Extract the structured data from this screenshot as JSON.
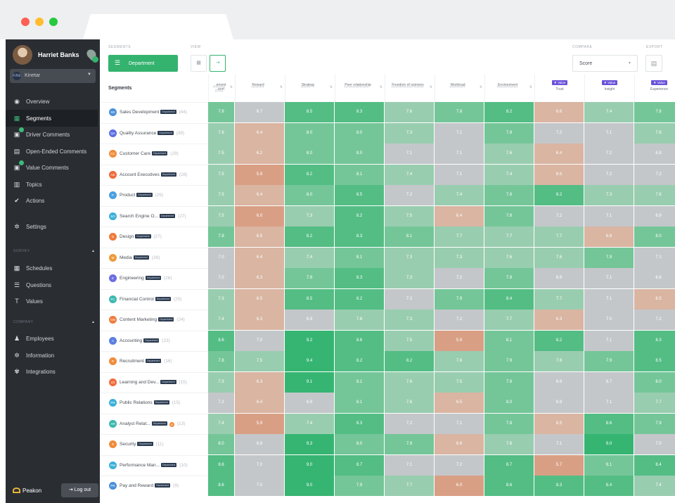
{
  "window": {
    "dots": [
      "#ff5f52",
      "#ffbd2e",
      "#27c93f"
    ]
  },
  "sidebar": {
    "user_name": "Harriet Banks",
    "org_logo": "KINE",
    "org_name": "Kinetar",
    "nav": [
      {
        "label": "Overview",
        "icon": "overview-icon",
        "glyph": "◉",
        "active": false,
        "badge": false
      },
      {
        "label": "Segments",
        "icon": "segments-icon",
        "glyph": "▦",
        "active": true,
        "badge": false
      },
      {
        "label": "Driver Comments",
        "icon": "driver-comments-icon",
        "glyph": "▣",
        "active": false,
        "badge": true
      },
      {
        "label": "Open-Ended Comments",
        "icon": "open-ended-comments-icon",
        "glyph": "▤",
        "active": false,
        "badge": false
      },
      {
        "label": "Value Comments",
        "icon": "value-comments-icon",
        "glyph": "▣",
        "active": false,
        "badge": true
      },
      {
        "label": "Topics",
        "icon": "topics-icon",
        "glyph": "▥",
        "active": false,
        "badge": false
      },
      {
        "label": "Actions",
        "icon": "actions-icon",
        "glyph": "✔",
        "active": false,
        "badge": false
      },
      {
        "label": "Settings",
        "icon": "settings-icon",
        "glyph": "✲",
        "active": false,
        "badge": false
      }
    ],
    "survey_heading": "SURVEY",
    "survey_items": [
      {
        "label": "Schedules",
        "icon": "schedules-icon",
        "glyph": "▦"
      },
      {
        "label": "Questions",
        "icon": "questions-icon",
        "glyph": "☰"
      },
      {
        "label": "Values",
        "icon": "values-icon",
        "glyph": "T"
      }
    ],
    "company_heading": "COMPANY",
    "company_items": [
      {
        "label": "Employees",
        "icon": "employees-icon",
        "glyph": "♟"
      },
      {
        "label": "Information",
        "icon": "information-icon",
        "glyph": "✲"
      },
      {
        "label": "Integrations",
        "icon": "integrations-icon",
        "glyph": "✾"
      }
    ],
    "brand": "Peakon",
    "logout_label": "Log out"
  },
  "toolbar": {
    "segments_label": "SEGMENTS",
    "view_label": "VIEW",
    "department_button": "Department",
    "compare_label": "COMPARE",
    "compare_value": "Score",
    "export_label": "EXPORT"
  },
  "segments_header": "Segments",
  "tag_label": "Department",
  "colors": {
    "high": "#34b36f",
    "mid": "#84c9a3",
    "neutral": "#c6c9cc",
    "low": "#dca98f",
    "value_badge": "#6b52d9",
    "accent": "#34b36f"
  },
  "chart_data": {
    "type": "heatmap",
    "columns": [
      {
        "label": "...ement ...port",
        "value": false
      },
      {
        "label": "Reward",
        "value": false
      },
      {
        "label": "Strategy",
        "value": false
      },
      {
        "label": "Peer relationship",
        "value": false
      },
      {
        "label": "Freedom of opinions",
        "value": false
      },
      {
        "label": "Workload",
        "value": false
      },
      {
        "label": "Environment",
        "value": false
      },
      {
        "label": "Trust",
        "value": true
      },
      {
        "label": "Insight",
        "value": true
      },
      {
        "label": "Experience",
        "value": true
      }
    ],
    "value_badge_label": "Value",
    "rows": [
      {
        "name": "Sales Development",
        "initials": "SD",
        "color": "#4a8fd8",
        "count": "(44)",
        "values": [
          7.8,
          6.7,
          8.5,
          8.3,
          7.6,
          7.8,
          8.2,
          6.6,
          7.4,
          7.8
        ]
      },
      {
        "name": "Quality Assurance",
        "initials": "QA",
        "color": "#5b6ee0",
        "count": "(39)",
        "values": [
          7.6,
          6.4,
          8.0,
          8.0,
          7.3,
          7.1,
          7.8,
          7.2,
          7.1,
          7.6
        ]
      },
      {
        "name": "Customer Care",
        "initials": "CC",
        "color": "#ef8c3b",
        "count": "(29)",
        "values": [
          7.5,
          6.2,
          8.0,
          8.0,
          7.1,
          7.1,
          7.6,
          6.4,
          7.2,
          6.8
        ]
      },
      {
        "name": "Account Executives",
        "initials": "AE",
        "color": "#ef6b3b",
        "count": "(28)",
        "values": [
          7.5,
          5.9,
          8.2,
          8.1,
          7.4,
          7.1,
          7.4,
          6.5,
          7.2,
          7.2
        ]
      },
      {
        "name": "Product",
        "initials": "P",
        "color": "#4aa0e0",
        "count": "(29)",
        "values": [
          7.5,
          6.4,
          8.0,
          8.5,
          7.2,
          7.4,
          7.8,
          8.2,
          7.3,
          7.6
        ]
      },
      {
        "name": "Search Engine O...",
        "initials": "SO",
        "color": "#3bb0d8",
        "count": "(27)",
        "values": [
          7.5,
          6.0,
          7.3,
          8.2,
          7.5,
          6.4,
          7.8,
          7.2,
          7.1,
          6.9
        ]
      },
      {
        "name": "Design",
        "initials": "D",
        "color": "#ef7a3b",
        "count": "(27)",
        "values": [
          7.8,
          6.5,
          8.2,
          8.3,
          8.1,
          7.7,
          7.7,
          7.7,
          6.6,
          8.0
        ]
      },
      {
        "name": "Media",
        "initials": "M",
        "color": "#ef9a3b",
        "count": "(26)",
        "values": [
          7.0,
          6.4,
          7.4,
          8.1,
          7.3,
          7.3,
          7.6,
          7.6,
          7.9,
          7.1
        ]
      },
      {
        "name": "Engineering",
        "initials": "E",
        "color": "#6b6ee0",
        "count": "(26)",
        "values": [
          7.0,
          6.3,
          7.8,
          8.3,
          7.3,
          7.2,
          7.8,
          6.9,
          7.1,
          6.8
        ]
      },
      {
        "name": "Financial Control",
        "initials": "FC",
        "color": "#3bb8b0",
        "count": "(25)",
        "values": [
          7.3,
          6.5,
          8.5,
          8.2,
          7.2,
          7.9,
          8.4,
          7.7,
          7.1,
          6.5
        ]
      },
      {
        "name": "Content Marketing",
        "initials": "CM",
        "color": "#ef7a3b",
        "count": "(24)",
        "values": [
          7.4,
          6.3,
          6.9,
          7.6,
          7.3,
          7.2,
          7.7,
          6.3,
          7.0,
          7.2
        ]
      },
      {
        "name": "Accounting",
        "initials": "A",
        "color": "#5b7ee0",
        "count": "(23)",
        "values": [
          8.6,
          7.0,
          9.2,
          8.6,
          7.5,
          5.9,
          8.1,
          8.2,
          7.1,
          8.3
        ]
      },
      {
        "name": "Recruitment",
        "initials": "R",
        "color": "#ef8c3b",
        "count": "(16)",
        "values": [
          7.8,
          7.5,
          9.4,
          8.2,
          8.2,
          7.6,
          7.9,
          7.6,
          7.9,
          8.5
        ]
      },
      {
        "name": "Learning and Dev...",
        "initials": "LD",
        "color": "#ef6b3b",
        "count": "(15)",
        "values": [
          7.3,
          6.3,
          9.1,
          8.1,
          7.6,
          7.5,
          7.8,
          6.9,
          6.7,
          8.0
        ]
      },
      {
        "name": "Public Relations",
        "initials": "PR",
        "color": "#3bb0d8",
        "count": "(15)",
        "values": [
          7.2,
          6.4,
          6.9,
          8.1,
          7.6,
          6.5,
          8.0,
          6.9,
          7.1,
          7.7
        ]
      },
      {
        "name": "Analyst Relat...",
        "initials": "AR",
        "color": "#3bb8b0",
        "count": "(13)",
        "flag": "B",
        "values": [
          7.4,
          5.9,
          7.4,
          8.3,
          7.2,
          7.1,
          7.8,
          6.5,
          8.6,
          7.9
        ]
      },
      {
        "name": "Security",
        "initials": "S",
        "color": "#ef8c3b",
        "count": "(11)",
        "values": [
          8.0,
          6.8,
          9.3,
          8.0,
          7.9,
          6.6,
          7.6,
          7.1,
          9.0,
          7.0
        ]
      },
      {
        "name": "Performance Man...",
        "initials": "PM",
        "color": "#3bb0d8",
        "count": "(10)",
        "values": [
          8.6,
          7.0,
          9.0,
          8.7,
          7.1,
          7.2,
          8.7,
          5.7,
          8.1,
          8.4
        ]
      },
      {
        "name": "Pay and Reward",
        "initials": "PR",
        "color": "#4a8fd8",
        "count": "(9)",
        "values": [
          8.6,
          7.0,
          9.0,
          7.9,
          7.7,
          6.0,
          8.6,
          8.3,
          8.4,
          7.4
        ]
      }
    ],
    "xlabel": "",
    "ylabel": ""
  }
}
